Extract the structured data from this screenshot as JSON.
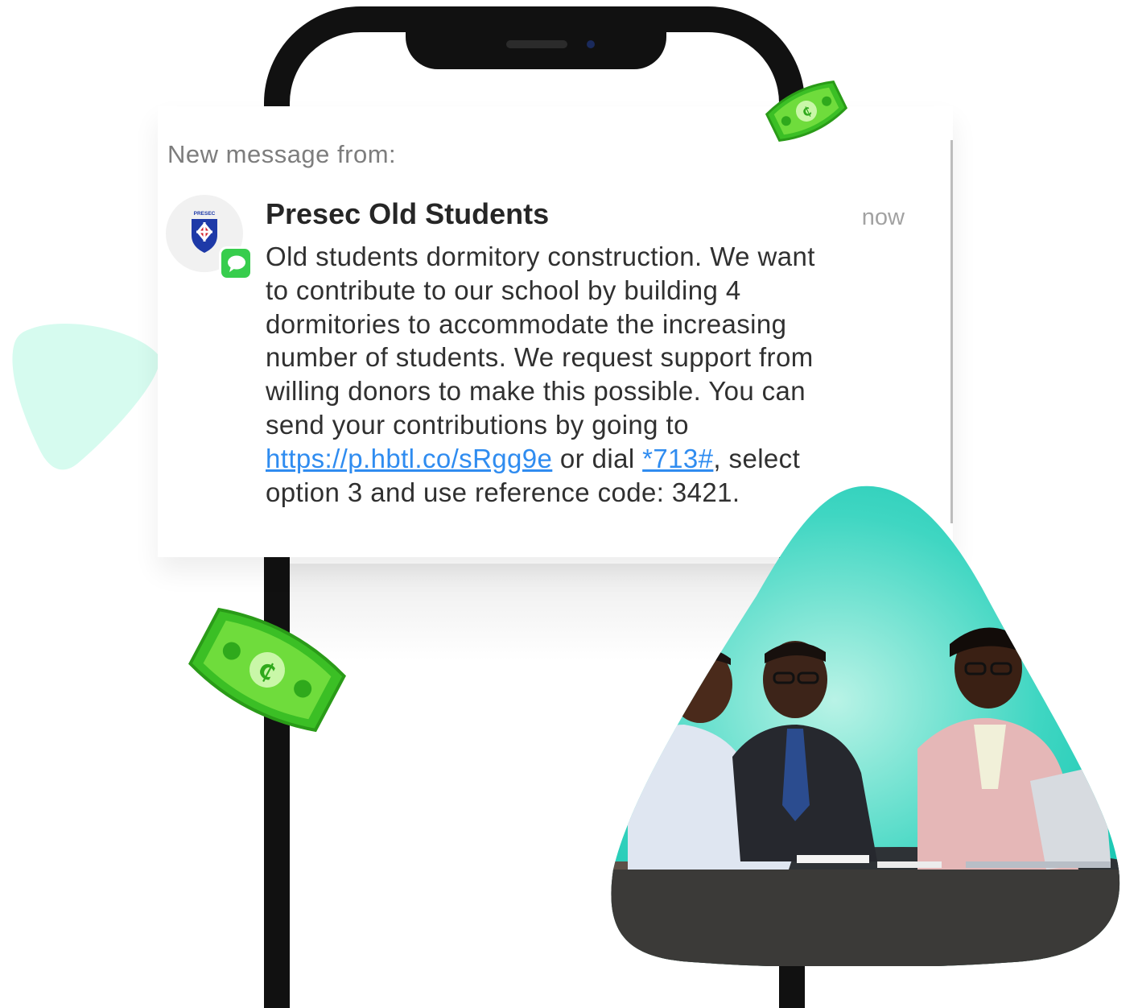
{
  "notification": {
    "header": "New message from:",
    "sender": "Presec Old Students",
    "timestamp": "now",
    "avatar_crest_text": "PRESEC",
    "body_lines": [
      "Old students dormitory construction. We want",
      "to contribute to our school by building 4",
      "dormitories to accommodate the increasing",
      "number of students. We request support from",
      "willing donors to make this possible.  You can",
      "send your contributions by going to"
    ],
    "link_url": "https://p.hbtl.co/sRgg9e",
    "mid_text": " or dial ",
    "ussd_code": "*713#",
    "after_code": ", select",
    "last_line": "option 3 and use reference code: 3421."
  },
  "icons": {
    "message_badge": "message-bubble-icon",
    "bill": "cedi-banknote-icon",
    "cedi_symbol": "₵"
  },
  "colors": {
    "link": "#2f8cf0",
    "message_badge": "#37cd4d",
    "bill_light": "#6fdc3c",
    "bill_dark": "#2fb21e",
    "teal": "#12c6b2",
    "blob": "#d6fbef"
  }
}
